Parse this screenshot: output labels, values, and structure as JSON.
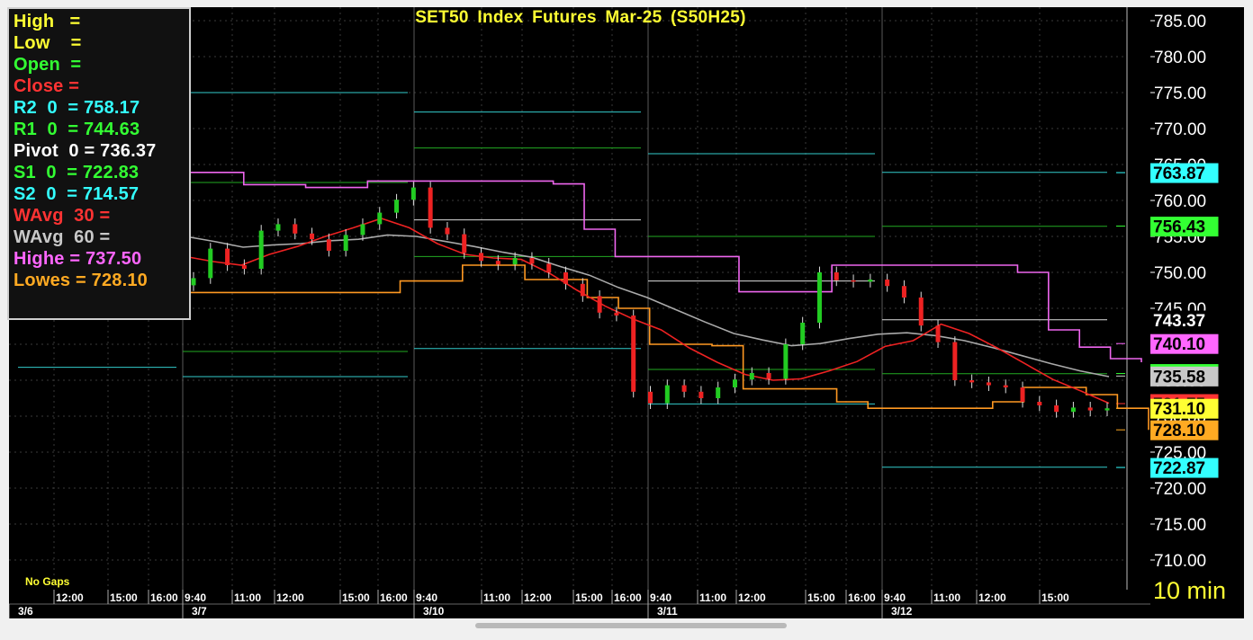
{
  "chart_data": {
    "type": "candlestick",
    "title": "SET50 Index Futures Mar-25 (S50H25)",
    "timeframe": "10 min",
    "note": "No Gaps",
    "ylim": [
      708,
      786
    ],
    "y_ticks": [
      "785.00",
      "780.00",
      "775.00",
      "770.00",
      "765.00",
      "760.00",
      "755.00",
      "750.00",
      "745.00",
      "740.00",
      "735.00",
      "730.00",
      "725.00",
      "720.00",
      "715.00",
      "710.00"
    ],
    "x_time_labels": [
      "12:00",
      "15:00",
      "16:00",
      "9:40",
      "11:00",
      "12:00",
      "15:00",
      "16:00",
      "9:40",
      "11:00",
      "12:00",
      "15:00",
      "16:00",
      "9:40",
      "11:00",
      "12:00",
      "15:00",
      "16:00",
      "9:40",
      "11:00",
      "12:00",
      "15:00"
    ],
    "x_date_labels": [
      "3/6",
      "3/7",
      "3/10",
      "3/11",
      "3/12"
    ],
    "legend": [
      {
        "label": "High",
        "spacer": "   ",
        "value": "",
        "color": "#ffff33"
      },
      {
        "label": "Low",
        "spacer": "    ",
        "value": "",
        "color": "#ffff33"
      },
      {
        "label": "Open",
        "spacer": "  ",
        "value": "",
        "color": "#33ff33"
      },
      {
        "label": "Close",
        "spacer": " ",
        "value": "",
        "color": "#ff3333"
      },
      {
        "label": "R2  0",
        "spacer": "  ",
        "value": "758.17",
        "color": "#33ffff"
      },
      {
        "label": "R1  0",
        "spacer": "  ",
        "value": "744.63",
        "color": "#33ff33"
      },
      {
        "label": "Pivot  0",
        "spacer": " ",
        "value": "736.37",
        "color": "#ffffff"
      },
      {
        "label": "S1  0",
        "spacer": "  ",
        "value": "722.83",
        "color": "#33ff33"
      },
      {
        "label": "S2  0",
        "spacer": "  ",
        "value": "714.57",
        "color": "#33ffff"
      },
      {
        "label": "WAvg  30",
        "spacer": " ",
        "value": "",
        "color": "#ff3333"
      },
      {
        "label": "WAvg  60",
        "spacer": " ",
        "value": "",
        "color": "#c8c8c8"
      },
      {
        "label": "Highe",
        "spacer": " ",
        "value": "737.50",
        "color": "#ff66ff"
      },
      {
        "label": "Lowes",
        "spacer": " ",
        "value": "728.10",
        "color": "#ffaa22"
      }
    ],
    "price_tags": [
      {
        "value": "763.87",
        "price": 763.87,
        "bg": "#33ffff",
        "fg": "#000000"
      },
      {
        "value": "756.43",
        "price": 756.43,
        "bg": "#33ff33",
        "fg": "#000000"
      },
      {
        "value": "743.37",
        "price": 743.37,
        "bg": "#000000",
        "fg": "#ffffff"
      },
      {
        "value": "740.10",
        "price": 740.1,
        "bg": "#ff66ff",
        "fg": "#000000"
      },
      {
        "value": "735.93",
        "price": 735.93,
        "bg": "#33ff33",
        "fg": "#000000"
      },
      {
        "value": "735.58",
        "price": 735.58,
        "bg": "#c8c8c8",
        "fg": "#000000"
      },
      {
        "value": "731.75",
        "price": 731.75,
        "bg": "#ff3333",
        "fg": "#000000"
      },
      {
        "value": "731.10",
        "price": 731.1,
        "bg": "#ffff33",
        "fg": "#000000"
      },
      {
        "value": "728.10",
        "price": 728.1,
        "bg": "#ffaa22",
        "fg": "#000000"
      },
      {
        "value": "722.87",
        "price": 722.87,
        "bg": "#33ffff",
        "fg": "#000000"
      }
    ],
    "pivot_levels": [
      {
        "day": "3/6",
        "R2": null,
        "R1": null,
        "P": null,
        "S1": null,
        "S2": 736.8
      },
      {
        "day": "3/7",
        "R2": 775.0,
        "R1": 762.5,
        "P": null,
        "S1": 739.0,
        "S2": 735.5
      },
      {
        "day": "3/10",
        "R2": 772.3,
        "R1": 767.3,
        "P": 757.3,
        "S1": 752.2,
        "S2": 739.4
      },
      {
        "day": "3/11",
        "R2": 766.5,
        "R1": 755.0,
        "P": 748.8,
        "S1": 736.5,
        "S2": 731.7
      },
      {
        "day": "3/12",
        "R2": 763.9,
        "R1": 756.4,
        "P": 743.4,
        "S1": 735.9,
        "S2": 722.9
      }
    ],
    "highest_values": [
      763.9,
      763.9,
      762.2,
      762.2,
      761.8,
      761.8,
      762.7,
      762.7,
      762.7,
      762.7,
      762.7,
      762.7,
      762.3,
      756.0,
      752.2,
      752.2,
      752.2,
      752.2,
      747.3,
      747.3,
      747.3,
      751.0,
      751.0,
      751.0,
      751.0,
      751.0,
      751.0,
      750.0,
      742.0,
      739.6,
      738.0,
      737.5
    ],
    "lowest_values": [
      747.2,
      747.2,
      747.2,
      747.2,
      747.2,
      747.2,
      747.2,
      748.8,
      748.8,
      751.0,
      751.0,
      749.0,
      749.0,
      746.5,
      745.0,
      740.0,
      740.0,
      739.8,
      733.8,
      733.8,
      733.8,
      732.0,
      731.1,
      731.1,
      731.1,
      731.1,
      732.0,
      734.0,
      734.0,
      733.0,
      731.1,
      728.1
    ],
    "wavg30_values": [
      752.2,
      751.5,
      751.0,
      752.5,
      753.6,
      755.0,
      756.2,
      757.5,
      756.2,
      754.0,
      752.5,
      752.0,
      751.8,
      749.9,
      747.5,
      745.3,
      743.5,
      742.0,
      739.5,
      737.5,
      735.8,
      735.0,
      735.2,
      736.3,
      737.6,
      739.7,
      740.5,
      742.8,
      741.5,
      739.5,
      737.3,
      735.1,
      733.5,
      731.8
    ],
    "wavg60_values": [
      755.0,
      754.3,
      753.5,
      753.8,
      754.0,
      754.4,
      754.6,
      755.2,
      755.0,
      754.3,
      753.6,
      752.8,
      752.1,
      750.8,
      749.6,
      747.9,
      746.5,
      744.8,
      743.1,
      741.5,
      740.6,
      739.8,
      740.1,
      740.8,
      741.4,
      741.6,
      741.2,
      740.5,
      739.5,
      738.4,
      737.3,
      736.3,
      735.5
    ],
    "close_series": [
      749.2,
      753.3,
      751.0,
      750.5,
      755.8,
      756.7,
      755.4,
      754.6,
      753.0,
      755.2,
      756.7,
      758.3,
      760.1,
      761.8,
      756.2,
      755.3,
      752.7,
      751.6,
      751.1,
      752.0,
      751.2,
      750.0,
      748.4,
      746.7,
      744.4,
      744.0,
      733.4,
      731.8,
      734.3,
      733.4,
      732.5,
      734.0,
      735.1,
      736.0,
      735.2,
      740.0,
      743.0,
      750.0,
      748.9,
      748.7,
      749.0,
      748.1,
      746.5,
      742.6,
      740.3,
      735.0,
      734.7,
      734.3,
      734.0,
      732.0,
      731.5,
      730.6,
      731.2,
      730.8,
      731.1
    ]
  }
}
